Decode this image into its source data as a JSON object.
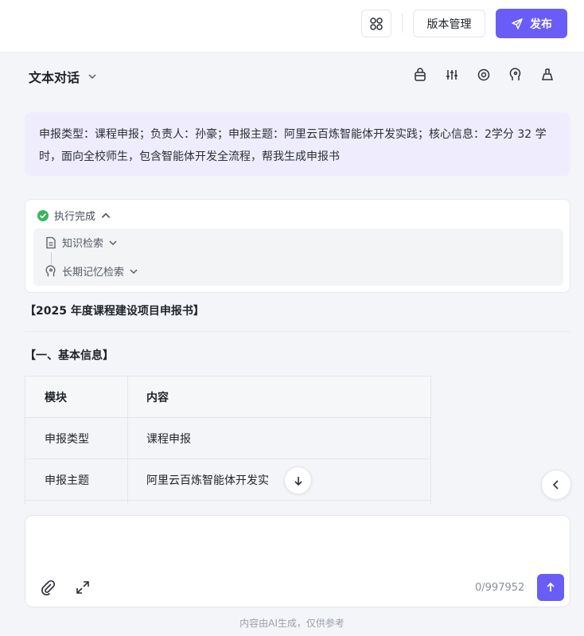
{
  "header": {
    "version_label": "版本管理",
    "publish_label": "发布"
  },
  "toolbar": {
    "mode_label": "文本对话"
  },
  "user_message": "申报类型：课程申报；负责人：孙豪；申报主题：阿里云百炼智能体开发实践；核心信息：2学分 32 学时，面向全校师生，包含智能体开发全流程，帮我生成申报书",
  "execution": {
    "status": "执行完成",
    "steps": [
      "知识检索",
      "长期记忆检索"
    ]
  },
  "document": {
    "title": "【2025 年度课程建设项目申报书】",
    "section_title": "【一、基本信息】",
    "table": {
      "headers": [
        "模块",
        "内容"
      ],
      "rows": [
        [
          "申报类型",
          "课程申报"
        ],
        [
          "申报主题",
          "阿里云百炼智能体开发实"
        ]
      ]
    }
  },
  "composer": {
    "placeholder": "",
    "counter": "0/997952"
  },
  "footer": {
    "disclaimer": "内容由AI生成，仅供参考"
  },
  "colors": {
    "accent": "#6a5cf6",
    "user_bubble": "#efedfd",
    "success": "#3bb55c"
  }
}
